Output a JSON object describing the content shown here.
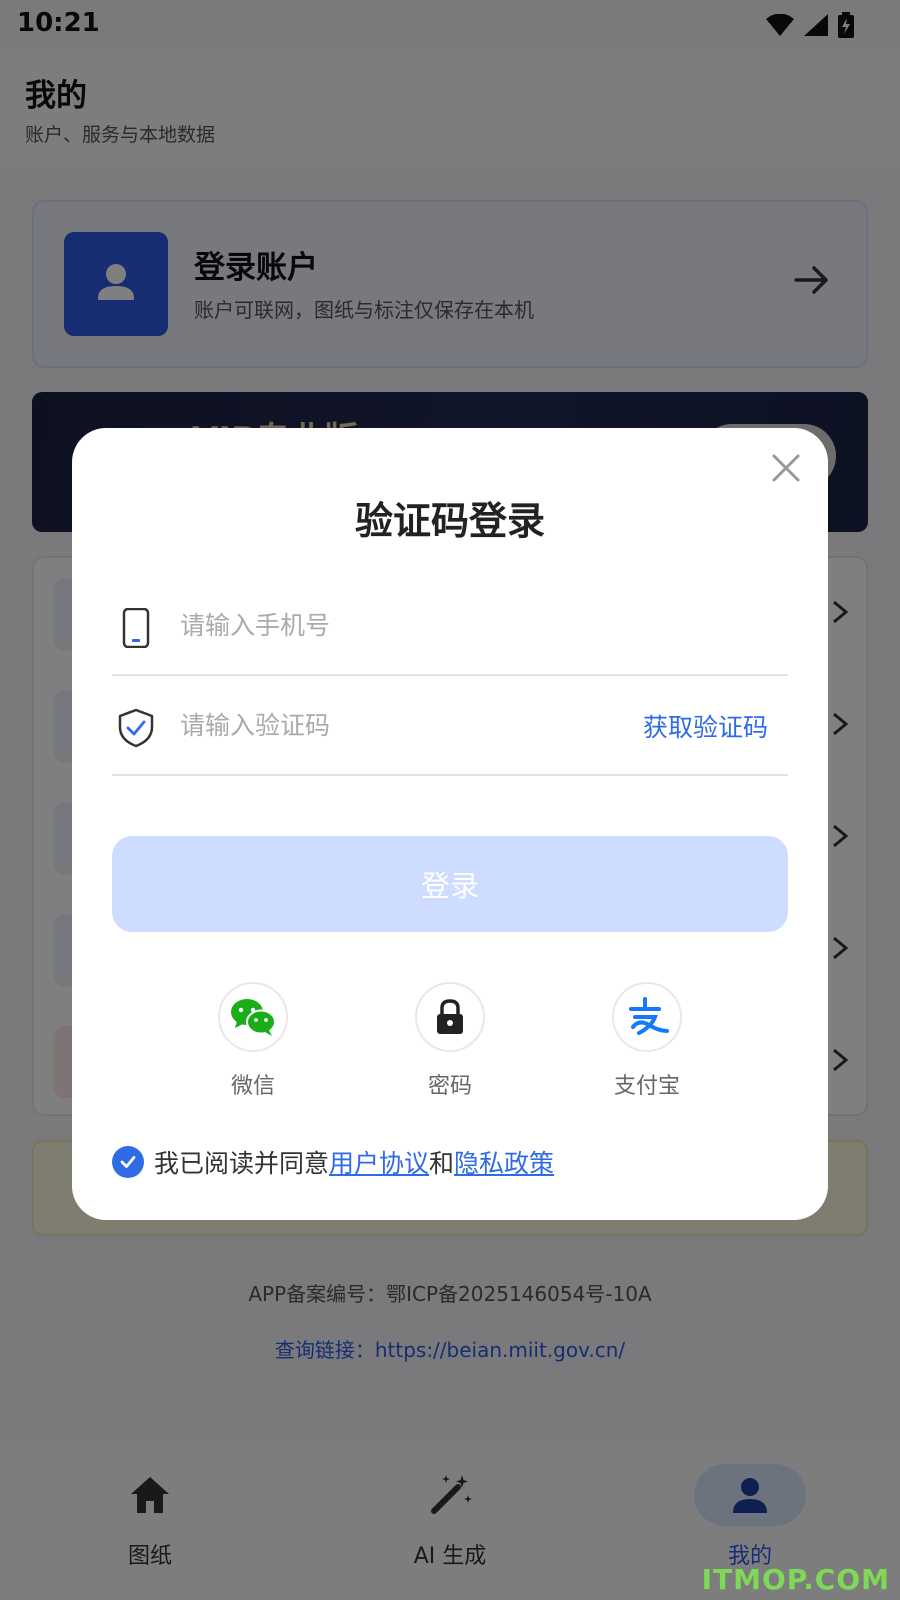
{
  "status_bar": {
    "time": "10:21"
  },
  "page": {
    "title": "我的",
    "subtitle": "账户、服务与本地数据"
  },
  "login_card": {
    "title": "登录账户",
    "description": "账户可联网，图纸与标注仅保存在本机"
  },
  "vip_banner": {
    "title": "VIP专业版"
  },
  "footer": {
    "icp_text": "APP备案编号：鄂ICP备2025146054号-10A",
    "icp_link": "查询链接：https://beian.miit.gov.cn/"
  },
  "bottom_nav": [
    {
      "label": "图纸",
      "icon": "home-icon"
    },
    {
      "label": "AI 生成",
      "icon": "magic-wand-icon"
    },
    {
      "label": "我的",
      "icon": "person-icon",
      "active": true
    }
  ],
  "dialog": {
    "title": "验证码登录",
    "phone_placeholder": "请输入手机号",
    "code_placeholder": "请输入验证码",
    "get_code_label": "获取验证码",
    "login_label": "登录",
    "social": [
      {
        "label": "微信",
        "icon": "wechat-icon"
      },
      {
        "label": "密码",
        "icon": "lock-icon"
      },
      {
        "label": "支付宝",
        "icon": "alipay-icon"
      }
    ],
    "agreement": {
      "prefix": "我已阅读并同意",
      "user_agreement": "用户协议",
      "and": "和",
      "privacy_policy": "隐私政策"
    }
  },
  "watermark": "ITMOP.COM",
  "colors": {
    "primary": "#2f6be6",
    "login_disabled": "#cddcff",
    "wechat": "#1aad19"
  }
}
